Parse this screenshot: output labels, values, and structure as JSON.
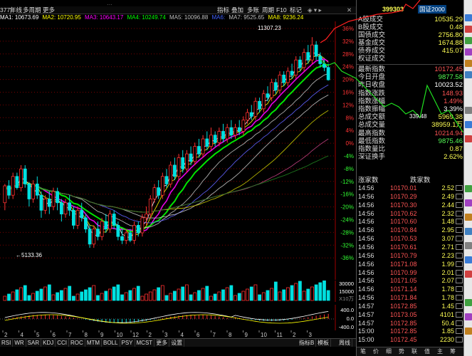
{
  "header": {
    "top_text": "…",
    "menu_tabs": [
      "指标",
      "叠加",
      "多账",
      "周期",
      "F10",
      "标记"
    ],
    "toolbar_left": [
      "377)",
      "年线",
      "多周期",
      "更多"
    ]
  },
  "ma_legend": [
    {
      "label": "MA1: 10673.69",
      "color": "#ffffff"
    },
    {
      "label": "MA2: 10720.95",
      "color": "#ffff00"
    },
    {
      "label": "MA3: 10643.17",
      "color": "#ff00ff"
    },
    {
      "label": "MA4: 10249.74",
      "color": "#00ff00"
    },
    {
      "label": "MA5: 10096.88",
      "color": "#c0c0c0"
    },
    {
      "label": "MA6:",
      "color": "#0000ff"
    },
    {
      "label": "MA7: 9525.65",
      "color": "#c0c0c0"
    },
    {
      "label": "MA8: 9236.24",
      "color": "#ffff00"
    }
  ],
  "chart_data": {
    "type": "candlestick",
    "high_label": "11307.23",
    "low_label": "5133.36",
    "percent_axis": [
      "36%",
      "32%",
      "28%",
      "24%",
      "20%",
      "16%",
      "12%",
      "8%",
      "4%",
      "0%",
      "-4%",
      "-8%",
      "-12%",
      "-16%",
      "-20%",
      "-24%",
      "-28%",
      "-32%",
      "-36%"
    ],
    "volume_axis": [
      "30000",
      "15000",
      "X10万"
    ],
    "macd_axis": [
      "400.0",
      "0.0",
      "-400.0"
    ],
    "date_labels": [
      "2",
      "4",
      "5",
      "6",
      "7",
      "8",
      "9",
      "10",
      "12",
      "2",
      "3",
      "4",
      "6",
      "7",
      "8",
      "9",
      "10",
      "11",
      "2",
      "3"
    ],
    "candles": [
      [
        6900,
        7350,
        6700,
        7400
      ],
      [
        7350,
        7100,
        7000,
        7500
      ],
      [
        7100,
        7600,
        7000,
        7700
      ],
      [
        7600,
        7300,
        7250,
        7700
      ],
      [
        7300,
        7800,
        7200,
        7900
      ],
      [
        7800,
        7400,
        7300,
        7900
      ],
      [
        7400,
        7000,
        6800,
        7450
      ],
      [
        7000,
        7400,
        6900,
        7500
      ],
      [
        7400,
        7100,
        7000,
        7600
      ],
      [
        7100,
        6700,
        6500,
        7200
      ],
      [
        6700,
        7000,
        6600,
        7100
      ],
      [
        7000,
        6800,
        6600,
        7200
      ],
      [
        6800,
        7200,
        6700,
        7300
      ],
      [
        7200,
        6900,
        6700,
        7300
      ],
      [
        6900,
        6600,
        6400,
        7000
      ],
      [
        6600,
        6900,
        6500,
        7000
      ],
      [
        6900,
        6700,
        6550,
        7100
      ],
      [
        6700,
        6300,
        6200,
        6800
      ],
      [
        6300,
        6700,
        6200,
        6800
      ],
      [
        6700,
        6500,
        6400,
        6900
      ],
      [
        6500,
        6200,
        6100,
        6600
      ],
      [
        6200,
        5800,
        5700,
        6300
      ],
      [
        5800,
        6200,
        5700,
        6300
      ],
      [
        6200,
        6000,
        5900,
        6400
      ],
      [
        6000,
        6400,
        5900,
        6500
      ],
      [
        6400,
        6200,
        6100,
        6600
      ],
      [
        6200,
        6600,
        6100,
        6700
      ],
      [
        6600,
        6300,
        6200,
        6700
      ],
      [
        6300,
        6000,
        5900,
        6400
      ],
      [
        6000,
        5900,
        5800,
        6200
      ],
      [
        5900,
        6100,
        5800,
        6200
      ],
      [
        6100,
        5900,
        5850,
        6200
      ],
      [
        5900,
        6300,
        5800,
        6400
      ],
      [
        6300,
        6100,
        6000,
        6400
      ],
      [
        6100,
        6500,
        6000,
        6600
      ],
      [
        6500,
        6600,
        6300,
        6800
      ],
      [
        6600,
        7000,
        6500,
        7100
      ],
      [
        7000,
        7300,
        6900,
        7400
      ],
      [
        7300,
        7100,
        7000,
        7500
      ],
      [
        7100,
        7600,
        7000,
        7700
      ],
      [
        7600,
        7400,
        7300,
        7800
      ],
      [
        7400,
        7900,
        7300,
        8000
      ],
      [
        7900,
        7600,
        7500,
        8100
      ],
      [
        7600,
        8100,
        7500,
        8200
      ],
      [
        8100,
        7800,
        7700,
        8300
      ],
      [
        7800,
        8200,
        7700,
        8300
      ],
      [
        8200,
        8000,
        7900,
        8400
      ],
      [
        8000,
        8400,
        7900,
        8500
      ],
      [
        8400,
        8200,
        8100,
        8600
      ],
      [
        8200,
        8600,
        8100,
        8700
      ],
      [
        8600,
        8400,
        8300,
        8800
      ],
      [
        8400,
        8700,
        8300,
        8900
      ],
      [
        8700,
        8500,
        8400,
        8800
      ],
      [
        8500,
        8800,
        8400,
        8900
      ],
      [
        8800,
        8600,
        8500,
        9000
      ],
      [
        8600,
        8900,
        8500,
        9000
      ],
      [
        8900,
        8700,
        8600,
        9100
      ],
      [
        8700,
        8900,
        8600,
        9000
      ],
      [
        8900,
        8800,
        8700,
        9100
      ],
      [
        8800,
        9100,
        8700,
        9200
      ],
      [
        9100,
        9300,
        9000,
        9400
      ],
      [
        9300,
        9200,
        9100,
        9500
      ],
      [
        9200,
        9600,
        9100,
        9700
      ],
      [
        9600,
        9400,
        9300,
        9700
      ],
      [
        9400,
        9800,
        9300,
        9900
      ],
      [
        9800,
        9700,
        9600,
        10000
      ],
      [
        9700,
        10100,
        9600,
        10200
      ],
      [
        10100,
        9900,
        9800,
        10200
      ],
      [
        9900,
        10300,
        9800,
        10400
      ],
      [
        10300,
        10100,
        10000,
        10400
      ],
      [
        10100,
        10400,
        10000,
        10500
      ],
      [
        10400,
        10300,
        10200,
        10600
      ],
      [
        10300,
        10700,
        10200,
        10800
      ],
      [
        10700,
        10500,
        10400,
        10800
      ],
      [
        10500,
        10900,
        10400,
        11000
      ],
      [
        10900,
        10700,
        10600,
        11100
      ],
      [
        10700,
        11100,
        10600,
        11307
      ],
      [
        11100,
        10800,
        10700,
        11200
      ],
      [
        10800,
        10600,
        10500,
        10900
      ],
      [
        10600,
        10500,
        10400,
        10700
      ],
      [
        10500,
        10172,
        10150,
        10600
      ]
    ]
  },
  "right_panel": {
    "code": "399303",
    "name": "国证2000",
    "rows_top": [
      {
        "label": "A股成交",
        "value": "10535.29",
        "color": "#ffff55"
      },
      {
        "label": "B股成交",
        "value": "0.48",
        "color": "#ffff55"
      },
      {
        "label": "国债成交",
        "value": "2756.80",
        "color": "#ffff55"
      },
      {
        "label": "基金成交",
        "value": "1674.88",
        "color": "#ffff55"
      },
      {
        "label": "债券成交",
        "value": "415.07",
        "color": "#ffff55"
      },
      {
        "label": "权证成交",
        "value": "",
        "color": "#ffff55"
      }
    ],
    "rows_index": [
      {
        "label": "最新指数",
        "value": "10172.45",
        "color": "#ff5555"
      },
      {
        "label": "今日开盘",
        "value": "9877.58",
        "color": "#55ff55"
      },
      {
        "label": "昨日收盘",
        "value": "10023.52",
        "color": "#ffffff"
      },
      {
        "label": "指数涨跌",
        "value": "148.93",
        "color": "#ff5555"
      },
      {
        "label": "指数涨幅",
        "value": "1.49%",
        "color": "#ff5555"
      },
      {
        "label": "指数振幅",
        "value": "3.39%",
        "color": "#ffffff"
      },
      {
        "label": "总成交额",
        "value": "5969.38",
        "color": "#ffff55"
      },
      {
        "label": "总成交量",
        "value": "38959.1万",
        "color": "#ffff55"
      },
      {
        "label": "最高指数",
        "value": "10214.94",
        "color": "#ff5555"
      },
      {
        "label": "最低指数",
        "value": "9875.46",
        "color": "#55ff55"
      },
      {
        "label": "指数量比",
        "value": "0.87",
        "color": "#ffff55"
      },
      {
        "label": "深证换手",
        "value": "2.62%",
        "color": "#ffff55"
      }
    ],
    "overlay_label": "339.48",
    "ticks_header": {
      "left": "涨家数",
      "right": "跌家数"
    },
    "ticks": [
      {
        "time": "14:56",
        "price": "10170.01",
        "vol": "2.52"
      },
      {
        "time": "14:56",
        "price": "10170.29",
        "vol": "2.49"
      },
      {
        "time": "14:56",
        "price": "10170.30",
        "vol": "2.44"
      },
      {
        "time": "14:56",
        "price": "10170.62",
        "vol": "2.32"
      },
      {
        "time": "14:56",
        "price": "10170.60",
        "vol": "1.48"
      },
      {
        "time": "14:56",
        "price": "10170.84",
        "vol": "2.95"
      },
      {
        "time": "14:56",
        "price": "10170.53",
        "vol": "3.07"
      },
      {
        "time": "14:56",
        "price": "10170.61",
        "vol": "2.71"
      },
      {
        "time": "14:56",
        "price": "10170.79",
        "vol": "2.23"
      },
      {
        "time": "14:56",
        "price": "10171.08",
        "vol": "1.99"
      },
      {
        "time": "14:56",
        "price": "10170.99",
        "vol": "2.01"
      },
      {
        "time": "14:56",
        "price": "10171.05",
        "vol": "2.07"
      },
      {
        "time": "14:56",
        "price": "10171.14",
        "vol": "1.78"
      },
      {
        "time": "14:56",
        "price": "10171.84",
        "vol": "1.78"
      },
      {
        "time": "14:57",
        "price": "10172.85",
        "vol": "1.45"
      },
      {
        "time": "14:57",
        "price": "10173.05",
        "vol": "4101"
      },
      {
        "time": "14:57",
        "price": "10172.85",
        "vol": "50.4"
      },
      {
        "time": "15:00",
        "price": "10172.85",
        "vol": "1.85"
      },
      {
        "time": "15:00",
        "price": "10172.45",
        "vol": "2230"
      }
    ],
    "bottom_tabs": [
      "笔",
      "价",
      "细",
      "势",
      "联",
      "值",
      "主",
      "筹"
    ]
  },
  "indicator_tabs": [
    "RSI",
    "WR",
    "SAR",
    "KDJ",
    "CCI",
    "ROC",
    "MTM",
    "BOLL",
    "PSY",
    "MCST",
    "更多",
    "设置"
  ],
  "indicator_right": [
    "指标B",
    "模板"
  ],
  "period_tab": "周线",
  "colors": {
    "up": "#ff3030",
    "down": "#00e0e0",
    "grid": "#7a0000",
    "axis_red": "#ff3333",
    "axis_green": "#33ff33"
  }
}
